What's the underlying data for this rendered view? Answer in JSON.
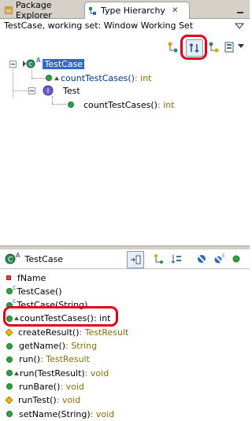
{
  "tabs": [
    {
      "label": "Package Explorer",
      "icon": "package-explorer-icon",
      "active": false
    },
    {
      "label": "Type Hierarchy",
      "icon": "type-hierarchy-icon",
      "active": true
    }
  ],
  "header": {
    "title": "TestCase, working set: Window Working Set"
  },
  "upper_tree": {
    "root": {
      "label": "TestCase",
      "badge": "A"
    },
    "root_method": {
      "name": "countTestCases()",
      "sig": " : int"
    },
    "interface": {
      "label": "Test"
    },
    "interface_method": {
      "name": "countTestCases()",
      "sig": " : int"
    }
  },
  "lower": {
    "title": "TestCase",
    "badge": "A",
    "members": [
      {
        "kind": "field-private",
        "name": "fName",
        "sig": ""
      },
      {
        "kind": "constructor",
        "name": "TestCase()",
        "sig": ""
      },
      {
        "kind": "constructor",
        "name": "TestCase(String)",
        "sig": ""
      },
      {
        "kind": "method-override",
        "name": "countTestCases()",
        "sig": " : int",
        "highlight": true
      },
      {
        "kind": "method-protected",
        "name": "createResult()",
        "sig": " : TestResult"
      },
      {
        "kind": "method",
        "name": "getName()",
        "sig": " : String"
      },
      {
        "kind": "method",
        "name": "run()",
        "sig": " : TestResult"
      },
      {
        "kind": "method-override",
        "name": "run(TestResult)",
        "sig": " : void"
      },
      {
        "kind": "method",
        "name": "runBare()",
        "sig": " : void"
      },
      {
        "kind": "method-protected",
        "name": "runTest()",
        "sig": " : void"
      },
      {
        "kind": "method",
        "name": "setName(String)",
        "sig": " : void"
      }
    ]
  },
  "colors": {
    "highlight_ring": "#e3001b",
    "selection": "#316ac5",
    "public_method": "#2ea043",
    "signature": "#8b6d00"
  }
}
